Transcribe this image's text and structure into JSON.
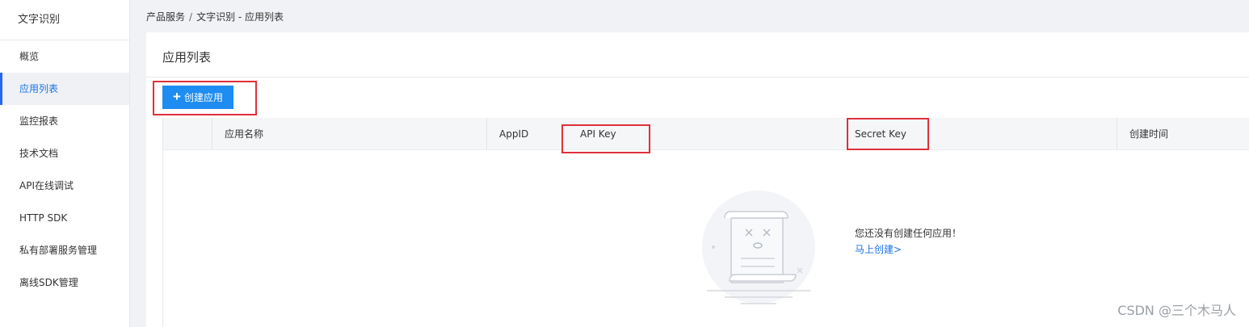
{
  "sidebar": {
    "title": "文字识别",
    "items": [
      {
        "label": "概览",
        "active": false
      },
      {
        "label": "应用列表",
        "active": true
      },
      {
        "label": "监控报表",
        "active": false
      },
      {
        "label": "技术文档",
        "active": false
      },
      {
        "label": "API在线调试",
        "active": false
      },
      {
        "label": "HTTP SDK",
        "active": false
      },
      {
        "label": "私有部署服务管理",
        "active": false
      },
      {
        "label": "离线SDK管理",
        "active": false
      }
    ]
  },
  "breadcrumb": {
    "root": "产品服务",
    "separator": "/",
    "current": "文字识别 - 应用列表"
  },
  "main": {
    "title": "应用列表",
    "create_button": {
      "icon": "plus-icon",
      "label": "创建应用"
    },
    "table": {
      "columns": [
        "应用名称",
        "AppID",
        "API Key",
        "Secret Key",
        "创建时间"
      ]
    },
    "empty": {
      "message": "您还没有创建任何应用！",
      "link": "马上创建>"
    }
  },
  "watermark": "CSDN @三个木马人",
  "colors": {
    "accent": "#1e8cf0",
    "highlight": "#e0303a",
    "link": "#1a73e8"
  }
}
